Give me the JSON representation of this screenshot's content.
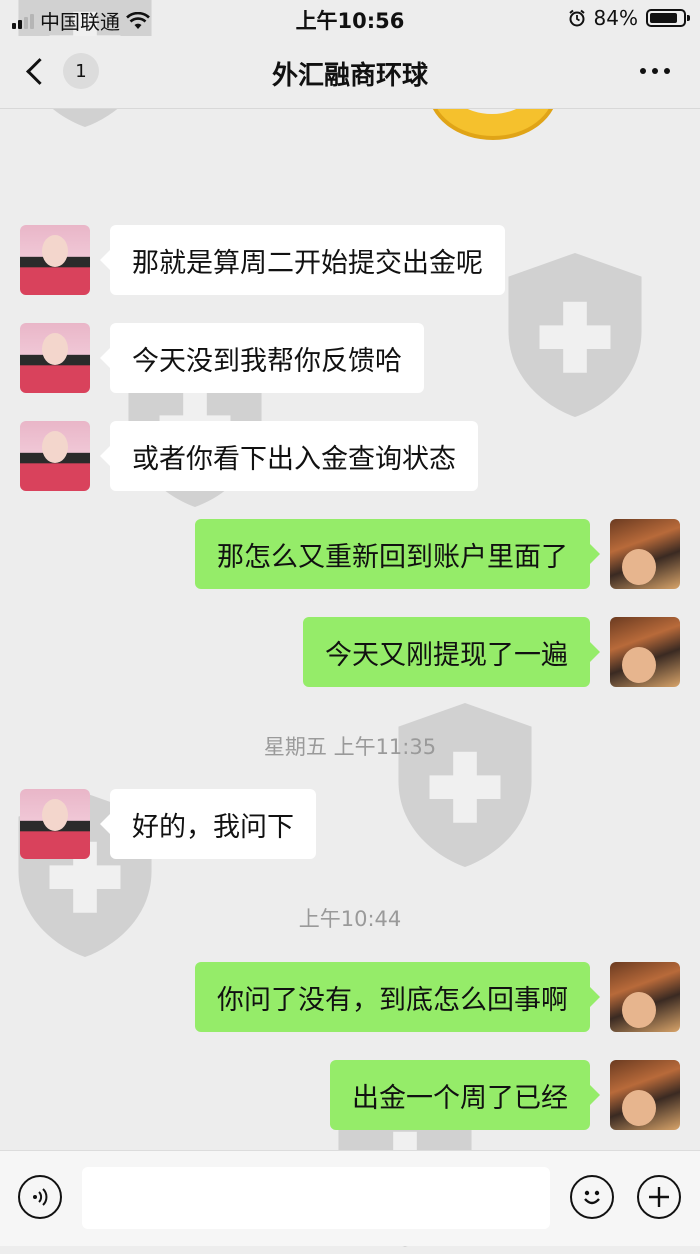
{
  "status_bar": {
    "carrier": "中国联通",
    "time": "上午10:56",
    "battery_percent": "84%",
    "battery_level": 0.84
  },
  "nav": {
    "unread_count": "1",
    "title": "外汇融商环球"
  },
  "messages": [
    {
      "side": "left",
      "text": "那就是算周二开始提交出金呢"
    },
    {
      "side": "left",
      "text": "今天没到我帮你反馈哈"
    },
    {
      "side": "left",
      "text": "或者你看下出入金查询状态"
    },
    {
      "side": "right",
      "text": "那怎么又重新回到账户里面了"
    },
    {
      "side": "right",
      "text": "今天又刚提现了一遍"
    },
    {
      "side": "left",
      "text": "好的，我问下"
    },
    {
      "side": "right",
      "text": "你问了没有，到底怎么回事啊"
    },
    {
      "side": "right",
      "text": "出金一个周了已经"
    }
  ],
  "timestamps": [
    "星期五 上午11:35",
    "上午10:44"
  ],
  "input_bar": {
    "voice_icon": "voice-icon",
    "emoji_icon": "emoji-icon",
    "plus_icon": "plus-icon"
  },
  "colors": {
    "bubble_self": "#95ec69",
    "bubble_other": "#ffffff",
    "background": "#ededed"
  }
}
